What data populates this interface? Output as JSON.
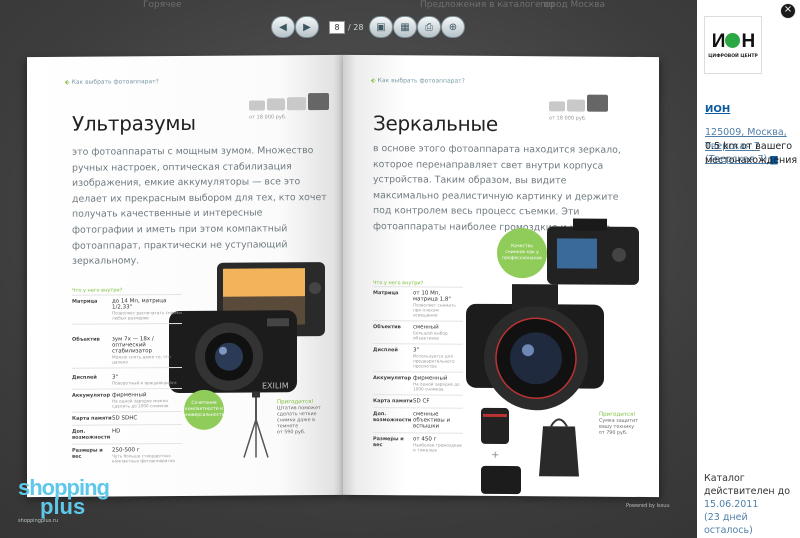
{
  "background_header": {
    "item1": "Горячее",
    "item2": "Предложения в каталоге во",
    "item3": "город Москва"
  },
  "toolbar": {
    "prev_icon": "arrow-left-icon",
    "next_icon": "arrow-right-icon",
    "current_page": "8",
    "total_pages": "/ 28",
    "buttons": [
      "view-spread-icon",
      "grid-icon",
      "print-icon",
      "zoom-icon"
    ]
  },
  "left_page": {
    "breadcrumb": "Как выбрать фотоаппарат?",
    "price_hint": "от 18 000 руб.",
    "title": "Ультразумы",
    "lead": "это фотоаппараты с мощным зумом. Множество ручных настроек, оптическая стабилизация изображения, емкие аккумуляторы — все это делает их прекрасным выбором для тех, кто хочет получать качественные и интересные фотографии и иметь при этом компактный фотоаппарат, практически не уступающий зеркальному.",
    "spec_title": "Что у него внутри?",
    "specs": [
      {
        "key": "Матрица",
        "val": "до 14 Мп, матрица 1/2,33\"",
        "desc": "Позволяет распечатать снимки любых размеров"
      },
      {
        "key": "Объектив",
        "val": "зум 7х — 18х / оптический стабилизатор",
        "desc": "Можно снять даже то, что далеко"
      },
      {
        "key": "Дисплей",
        "val": "3\"",
        "desc": "Поворотный и вращающийся"
      },
      {
        "key": "Аккумулятор",
        "val": "фирменный",
        "desc": "На одной зарядке можно сделать до 1000 снимков"
      },
      {
        "key": "Карта памяти",
        "val": "SD SDHC",
        "desc": ""
      },
      {
        "key": "Доп. возможности",
        "val": "HD",
        "desc": ""
      },
      {
        "key": "Размеры и вес",
        "val": "250-500 г",
        "desc": "Чуть больше стандартных компактных фотоаппаратов"
      }
    ],
    "bubble_text": "Сочетание компактности и универсальности",
    "tip_title": "Пригодится!",
    "tip_text": "Штатив поможет сделать четкие снимки даже в темноте",
    "tip_price": "от 590 руб."
  },
  "right_page": {
    "breadcrumb": "Как выбрать фотоаппарат?",
    "price_hint": "от 18 000 руб.",
    "title": "Зеркальные",
    "lead": "в основе этого фотоаппарата находится зеркало, которое перенаправляет свет внутри корпуса устройства. Таким образом, вы видите максимально реалистичную картинку и держите под контролем весь процесс съемки. Эти фотоаппараты наиболее громоздкие и хрупкие.",
    "spec_title": "Что у него внутри?",
    "specs": [
      {
        "key": "Матрица",
        "val": "от 10 Мп, матрица 1,8\"",
        "desc": "Позволяет снимать при плохом освещении"
      },
      {
        "key": "Объектив",
        "val": "сменный",
        "desc": "Большой выбор объективов"
      },
      {
        "key": "Дисплей",
        "val": "3\"",
        "desc": "Используется для предварительного просмотра"
      },
      {
        "key": "Аккумулятор",
        "val": "фирменный",
        "desc": "На одной зарядке до 1000 снимков"
      },
      {
        "key": "Карта памяти",
        "val": "SD CF",
        "desc": ""
      },
      {
        "key": "Доп. возможности",
        "val": "сменные объективы и вспышки",
        "desc": ""
      },
      {
        "key": "Размеры и вес",
        "val": "от 450 г",
        "desc": "Наиболее громоздкие и тяжелые"
      }
    ],
    "bubble_text": "Качество снимков как у профессионалов",
    "tip_title": "Пригодится!",
    "tip_text": "Сумка защитит вашу технику",
    "tip_price": "от 790 руб."
  },
  "sidebar": {
    "store_name": "ИОН",
    "logo_sub": "ЦИФРОВОЙ ЦЕНТР",
    "address": "125009, Москва, Тверская 7 (Тверская 7)",
    "distance": "0.5 km от вашего местонахождения",
    "valid_label": "Каталог действителен до",
    "valid_date": "15.06.2011",
    "days_left": "(23 дней осталось)",
    "close_icon": "close-icon",
    "map_icon": "map-icon"
  },
  "branding": {
    "line1": "shopping",
    "line2": "plus",
    "site": "shoppingplus.ru",
    "powered": "Powered by Issuu"
  }
}
